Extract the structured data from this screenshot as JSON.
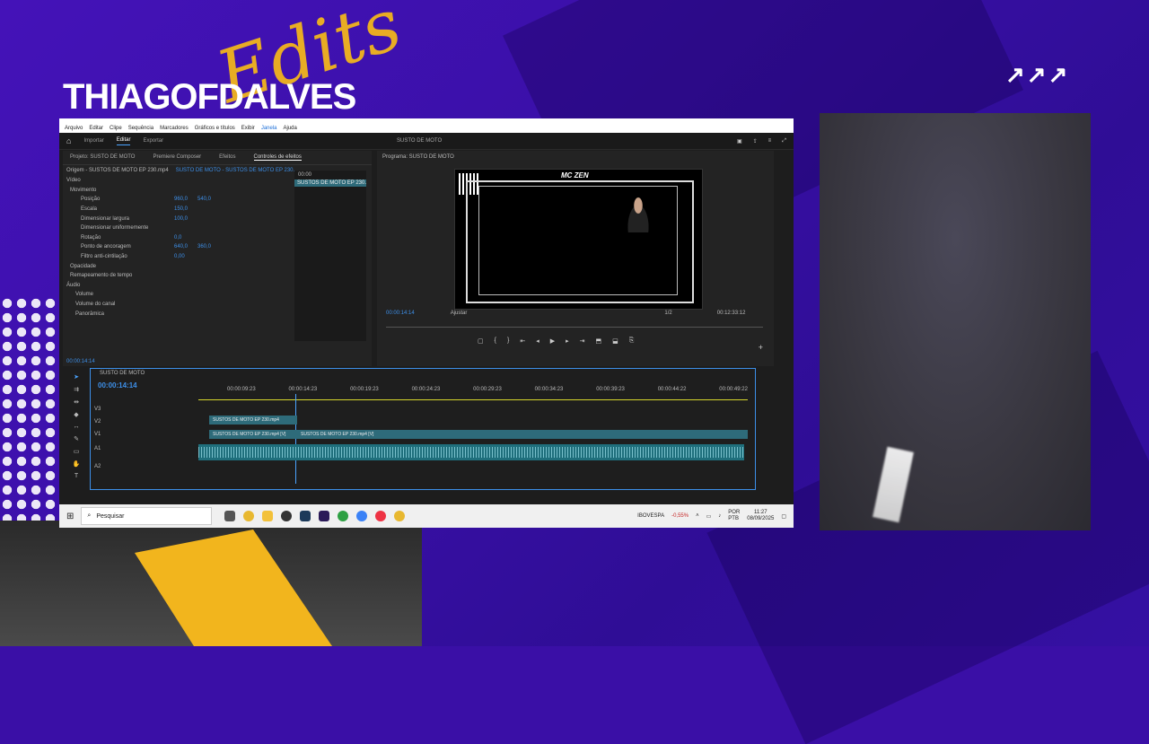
{
  "brand": {
    "name": "THIAGOFDALVES",
    "script": "Edits"
  },
  "corner_arrows": "↗↗↗",
  "menu": [
    "Arquivo",
    "Editar",
    "Clipe",
    "Sequência",
    "Marcadores",
    "Gráficos e títulos",
    "Exibir",
    "Janela",
    "Ajuda"
  ],
  "app": {
    "tabs": [
      "Importar",
      "Editar",
      "Exportar"
    ],
    "active_tab": "Editar",
    "project_title": "SUSTO DE MOTO"
  },
  "source_panel": {
    "tabs": [
      "Projeto: SUSTO DE MOTO",
      "Premiere Composer",
      "Efeitos",
      "Controles de efeitos"
    ],
    "origin": "Origem - SUSTOS DE MOTO EP  230.mp4",
    "sequence": "SUSTO DE MOTO - SUSTOS DE MOTO EP  230...",
    "mini_time": "00:00",
    "mini_clip": "SUSTOS DE MOTO EP  230.mp4",
    "section_video": "Vídeo",
    "rows": [
      {
        "label": "Movimento",
        "v1": "",
        "v2": ""
      },
      {
        "label": "Posição",
        "v1": "960,0",
        "v2": "540,0"
      },
      {
        "label": "Escala",
        "v1": "150,0",
        "v2": ""
      },
      {
        "label": "Dimensionar largura",
        "v1": "100,0",
        "v2": ""
      },
      {
        "label": "Dimensionar uniformemente",
        "v1": "",
        "v2": ""
      },
      {
        "label": "Rotação",
        "v1": "0,0",
        "v2": ""
      },
      {
        "label": "Ponto de ancoragem",
        "v1": "640,0",
        "v2": "360,0"
      },
      {
        "label": "Filtro anti-cintilação",
        "v1": "0,00",
        "v2": ""
      },
      {
        "label": "Opacidade",
        "v1": "",
        "v2": ""
      },
      {
        "label": "Remapeamento de tempo",
        "v1": "",
        "v2": ""
      }
    ],
    "section_audio": "Áudio",
    "audio_rows": [
      "Volume",
      "Volume do canal",
      "Panorâmica"
    ],
    "timecode": "00:00:14:14"
  },
  "program": {
    "title": "Programa: SUSTO DE MOTO",
    "overlay_title": "MC ZEN",
    "timecode": "00:00:14:14",
    "fit": "Ajustar",
    "quality": "1/2",
    "duration": "00:12:33:12"
  },
  "timeline": {
    "title": "SUSTO DE MOTO",
    "timecode": "00:00:14:14",
    "ruler": [
      "00:00:09:23",
      "00:00:14:23",
      "00:00:19:23",
      "00:00:24:23",
      "00:00:29:23",
      "00:00:34:23",
      "00:00:39:23",
      "00:00:44:22",
      "00:00:49:22"
    ],
    "tracks": [
      "V3",
      "V2",
      "V1",
      "A1",
      "A2"
    ],
    "clip_v2": "SUSTOS DE MOTO EP  230.mp4",
    "clip_v1a": "SUSTOS DE MOTO EP  230.mp4 [V]",
    "clip_v1b": "SUSTOS DE MOTO EP  230.mp4 [V]",
    "fx": "fx"
  },
  "taskbar": {
    "search": "Pesquisar",
    "stock": "IBOVESPA",
    "stock_change": "-0,55%",
    "lang": "POR",
    "lang2": "PTB",
    "time": "11:27",
    "date": "08/09/2025"
  }
}
